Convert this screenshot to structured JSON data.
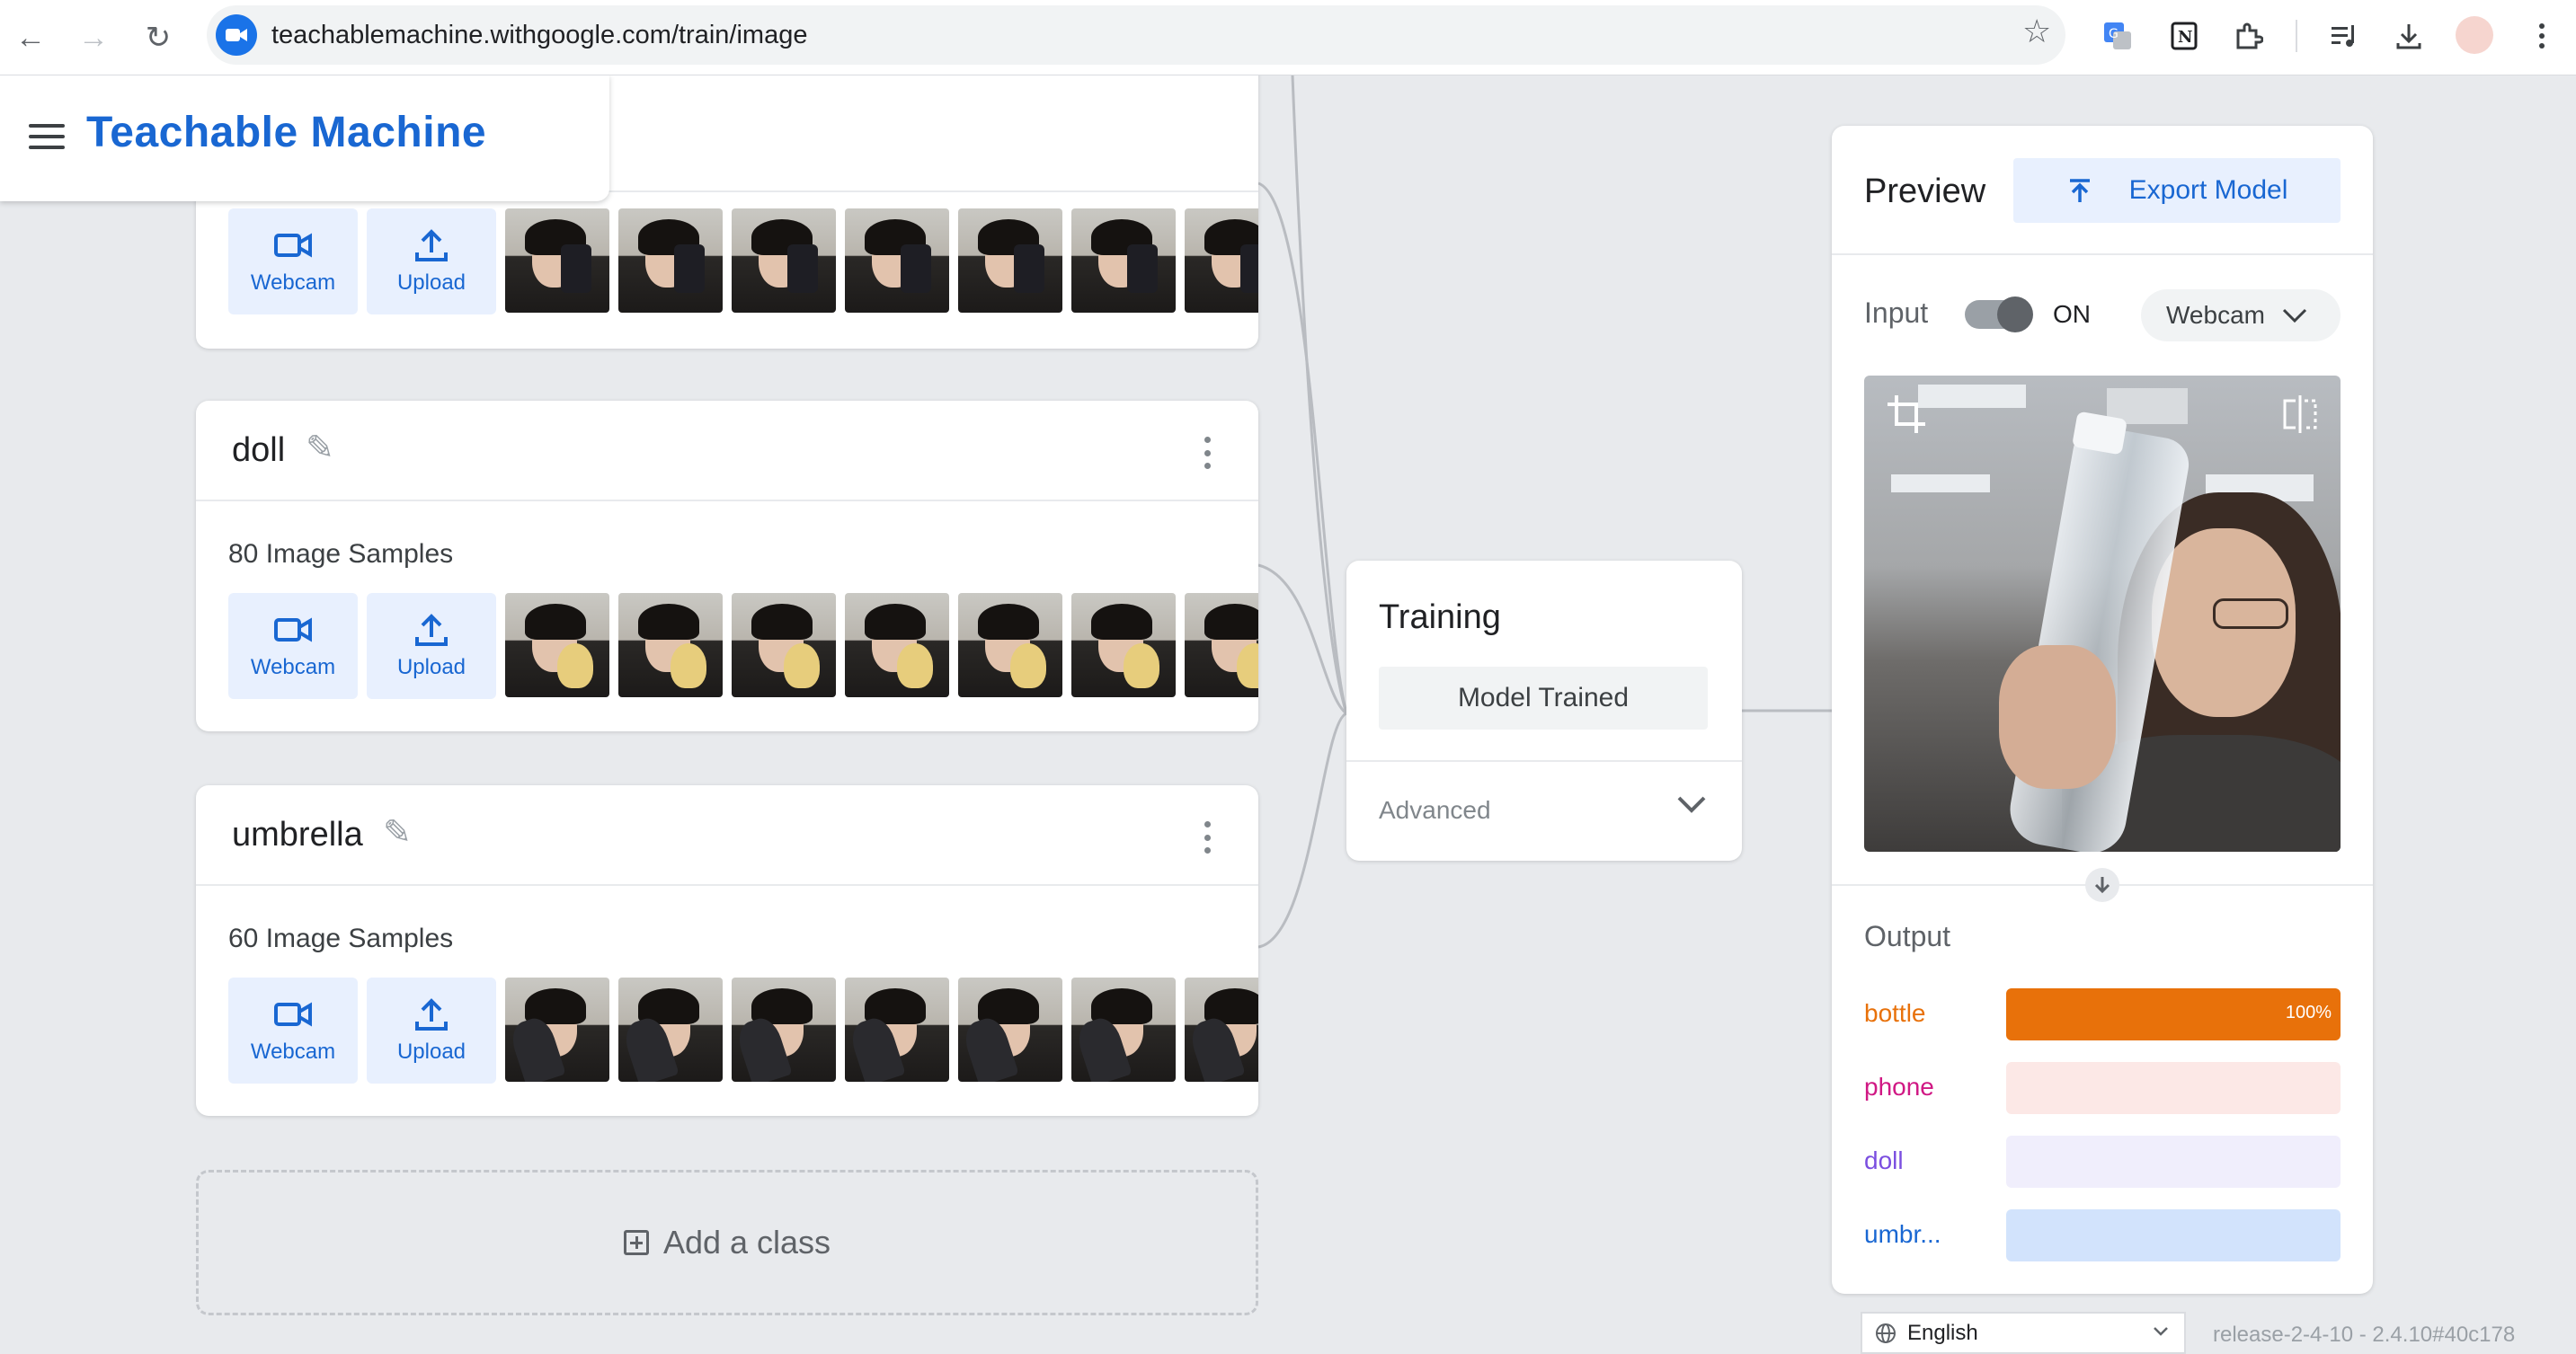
{
  "browser": {
    "url": "teachablemachine.withgoogle.com/train/image"
  },
  "app": {
    "title": "Teachable Machine"
  },
  "classes": [
    {
      "name": "",
      "samples_label": "",
      "webcam_label": "Webcam",
      "upload_label": "Upload",
      "object_icon": "phone"
    },
    {
      "name": "doll",
      "samples_label": "80 Image Samples",
      "webcam_label": "Webcam",
      "upload_label": "Upload",
      "object_icon": "doll"
    },
    {
      "name": "umbrella",
      "samples_label": "60 Image Samples",
      "webcam_label": "Webcam",
      "upload_label": "Upload",
      "object_icon": "umbrella"
    }
  ],
  "add_class": {
    "label": "Add a class"
  },
  "training": {
    "title": "Training",
    "button_label": "Model Trained",
    "advanced_label": "Advanced"
  },
  "preview": {
    "title": "Preview",
    "export_label": "Export Model",
    "input_label": "Input",
    "toggle_state": "ON",
    "source_label": "Webcam",
    "output_label": "Output",
    "outputs": [
      {
        "name": "bottle",
        "percent_label": "100%",
        "fraction": 1.0,
        "text_color": "#e8710a",
        "fill_color": "#e8710a",
        "track_color": "#fde3cf"
      },
      {
        "name": "phone",
        "percent_label": "",
        "fraction": 0.0,
        "text_color": "#d01884",
        "fill_color": "#d01884",
        "track_color": "#fce8e6"
      },
      {
        "name": "doll",
        "percent_label": "",
        "fraction": 0.0,
        "text_color": "#7b4fe0",
        "fill_color": "#7b4fe0",
        "track_color": "#f0eefc"
      },
      {
        "name": "umbr...",
        "percent_label": "",
        "fraction": 0.0,
        "text_color": "#1967d2",
        "fill_color": "#1967d2",
        "track_color": "#d2e3fc"
      }
    ]
  },
  "footer": {
    "language": "English",
    "release": "release-2-4-10 - 2.4.10#40c178"
  },
  "colors": {
    "brand_blue": "#1967d2",
    "button_bg": "#e8f0fe",
    "canvas_bg": "#e8eaed"
  }
}
